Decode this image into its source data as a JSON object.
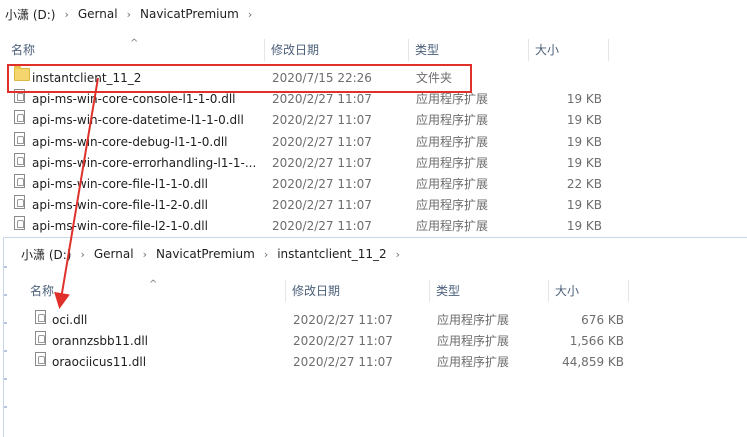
{
  "window1": {
    "breadcrumb": [
      "小潇 (D:)",
      "Gernal",
      "NavicatPremium"
    ],
    "columns": {
      "name": "名称",
      "modified": "修改日期",
      "type": "类型",
      "size": "大小"
    },
    "files": [
      {
        "name": "instantclient_11_2",
        "modified": "2020/7/15 22:26",
        "type": "文件夹",
        "size": "",
        "icon": "folder-icon"
      },
      {
        "name": "api-ms-win-core-console-l1-1-0.dll",
        "modified": "2020/2/27 11:07",
        "type": "应用程序扩展",
        "size": "19 KB",
        "icon": "dll-file-icon"
      },
      {
        "name": "api-ms-win-core-datetime-l1-1-0.dll",
        "modified": "2020/2/27 11:07",
        "type": "应用程序扩展",
        "size": "19 KB",
        "icon": "dll-file-icon"
      },
      {
        "name": "api-ms-win-core-debug-l1-1-0.dll",
        "modified": "2020/2/27 11:07",
        "type": "应用程序扩展",
        "size": "19 KB",
        "icon": "dll-file-icon"
      },
      {
        "name": "api-ms-win-core-errorhandling-l1-1-...",
        "modified": "2020/2/27 11:07",
        "type": "应用程序扩展",
        "size": "19 KB",
        "icon": "dll-file-icon"
      },
      {
        "name": "api-ms-win-core-file-l1-1-0.dll",
        "modified": "2020/2/27 11:07",
        "type": "应用程序扩展",
        "size": "22 KB",
        "icon": "dll-file-icon"
      },
      {
        "name": "api-ms-win-core-file-l1-2-0.dll",
        "modified": "2020/2/27 11:07",
        "type": "应用程序扩展",
        "size": "19 KB",
        "icon": "dll-file-icon"
      },
      {
        "name": "api-ms-win-core-file-l2-1-0.dll",
        "modified": "2020/2/27 11:07",
        "type": "应用程序扩展",
        "size": "19 KB",
        "icon": "dll-file-icon"
      }
    ]
  },
  "window2": {
    "breadcrumb": [
      "小潇 (D:)",
      "Gernal",
      "NavicatPremium",
      "instantclient_11_2"
    ],
    "columns": {
      "name": "名称",
      "modified": "修改日期",
      "type": "类型",
      "size": "大小"
    },
    "files": [
      {
        "name": "oci.dll",
        "modified": "2020/2/27 11:07",
        "type": "应用程序扩展",
        "size": "676 KB",
        "icon": "dll-file-icon"
      },
      {
        "name": "orannzsbb11.dll",
        "modified": "2020/2/27 11:07",
        "type": "应用程序扩展",
        "size": "1,566 KB",
        "icon": "dll-file-icon"
      },
      {
        "name": "oraociicus11.dll",
        "modified": "2020/2/27 11:07",
        "type": "应用程序扩展",
        "size": "44,859 KB",
        "icon": "dll-file-icon"
      }
    ]
  },
  "annotation": {
    "highlight_color": "#e0302a",
    "arrow_color": "#e0302a"
  },
  "glyphs": {
    "breadcrumb_separator": "›",
    "sort_arrow": "^"
  }
}
